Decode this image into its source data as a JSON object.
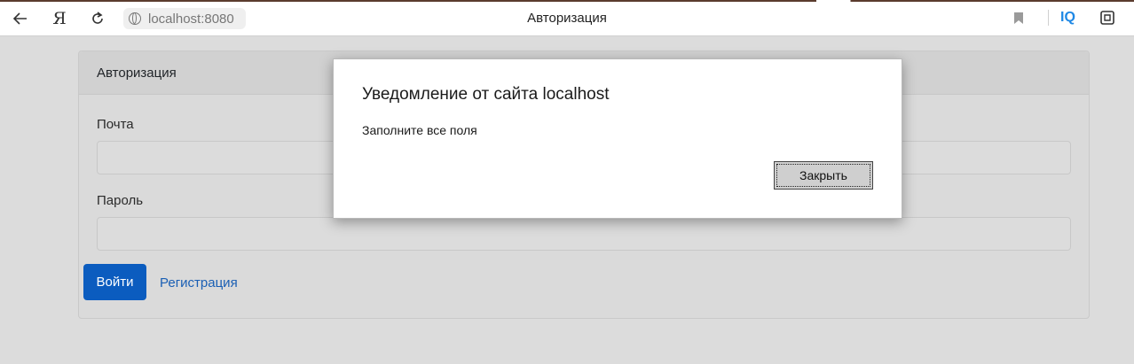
{
  "browser": {
    "url": "localhost:8080",
    "page_title": "Авторизация",
    "yandex_letter": "Я",
    "iq_label": "IQ",
    "accent_color": "#5a3b2e"
  },
  "form": {
    "header": "Авторизация",
    "email_label": "Почта",
    "email_value": "",
    "password_label": "Пароль",
    "password_value": "",
    "login_button": "Войти",
    "register_link": "Регистрация",
    "primary_color": "#0b5cbf"
  },
  "dialog": {
    "title": "Уведомление от сайта localhost",
    "message": "Заполните все поля",
    "close_button": "Закрыть"
  },
  "icons": [
    "back-arrow-icon",
    "reload-icon",
    "globe-icon",
    "bookmark-icon",
    "extensions-icon"
  ]
}
